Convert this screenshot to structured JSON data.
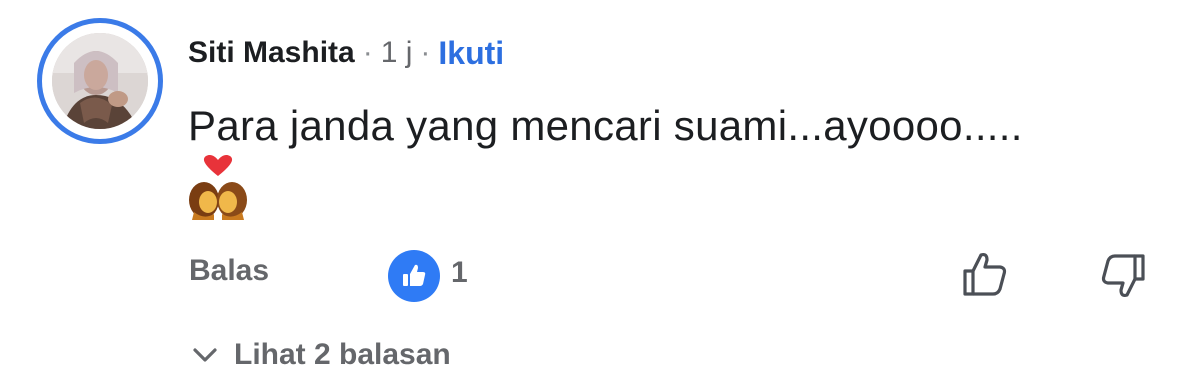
{
  "comment": {
    "author": "Siti Mashita",
    "separator": "·",
    "time": "1 j",
    "follow_label": "Ikuti",
    "text": "Para janda yang mencari suami...ayoooo.....",
    "emoji": "couple-with-heart",
    "reply_label": "Balas",
    "like_count": "1",
    "view_replies_label": "Lihat 2 balasan"
  },
  "colors": {
    "accent": "#2d6fe0",
    "avatar_ring": "#3b7be8",
    "muted_text": "#65676b",
    "primary_text": "#1c1e21"
  },
  "icons": {
    "like_badge": "thumbs-up-icon",
    "upvote": "thumb-up-outline-icon",
    "downvote": "thumb-down-outline-icon",
    "expand": "chevron-down-icon"
  }
}
